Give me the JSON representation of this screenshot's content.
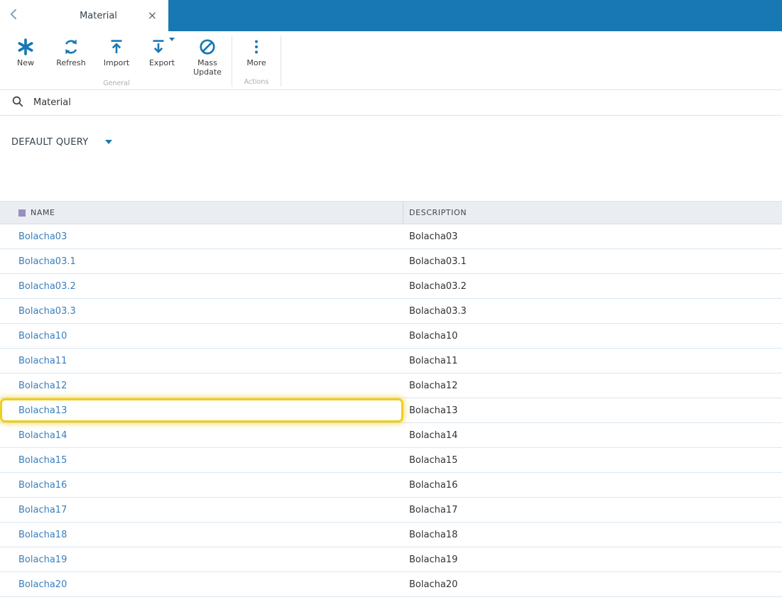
{
  "colors": {
    "accent": "#1878b4",
    "link": "#3a7ebc",
    "highlight": "#f0cd1f",
    "table_header_bg": "#eaedf1",
    "row_border": "#d9e7f2"
  },
  "window": {
    "tab_title": "Material",
    "close_glyph": "×"
  },
  "toolbar": {
    "groups": [
      {
        "label": "General",
        "buttons": [
          {
            "label": "New",
            "icon": "new-asterisk-icon"
          },
          {
            "label": "Refresh",
            "icon": "refresh-icon"
          },
          {
            "label": "Import",
            "icon": "import-icon"
          },
          {
            "label": "Export",
            "icon": "export-icon",
            "has_dropdown": true
          },
          {
            "label": "Mass Update",
            "icon": "mass-update-icon"
          }
        ]
      },
      {
        "label": "Actions",
        "buttons": [
          {
            "label": "More",
            "icon": "more-vertical-dots-icon"
          }
        ]
      }
    ]
  },
  "search": {
    "value": "Material"
  },
  "query": {
    "label": "DEFAULT QUERY"
  },
  "table": {
    "columns": [
      {
        "label": "NAME"
      },
      {
        "label": "DESCRIPTION"
      }
    ],
    "rows": [
      {
        "name": "Bolacha03",
        "description": "Bolacha03",
        "highlighted": false
      },
      {
        "name": "Bolacha03.1",
        "description": "Bolacha03.1",
        "highlighted": false
      },
      {
        "name": "Bolacha03.2",
        "description": "Bolacha03.2",
        "highlighted": false
      },
      {
        "name": "Bolacha03.3",
        "description": "Bolacha03.3",
        "highlighted": false
      },
      {
        "name": "Bolacha10",
        "description": "Bolacha10",
        "highlighted": false
      },
      {
        "name": "Bolacha11",
        "description": "Bolacha11",
        "highlighted": false
      },
      {
        "name": "Bolacha12",
        "description": "Bolacha12",
        "highlighted": false
      },
      {
        "name": "Bolacha13",
        "description": "Bolacha13",
        "highlighted": true
      },
      {
        "name": "Bolacha14",
        "description": "Bolacha14",
        "highlighted": false
      },
      {
        "name": "Bolacha15",
        "description": "Bolacha15",
        "highlighted": false
      },
      {
        "name": "Bolacha16",
        "description": "Bolacha16",
        "highlighted": false
      },
      {
        "name": "Bolacha17",
        "description": "Bolacha17",
        "highlighted": false
      },
      {
        "name": "Bolacha18",
        "description": "Bolacha18",
        "highlighted": false
      },
      {
        "name": "Bolacha19",
        "description": "Bolacha19",
        "highlighted": false
      },
      {
        "name": "Bolacha20",
        "description": "Bolacha20",
        "highlighted": false
      }
    ]
  }
}
